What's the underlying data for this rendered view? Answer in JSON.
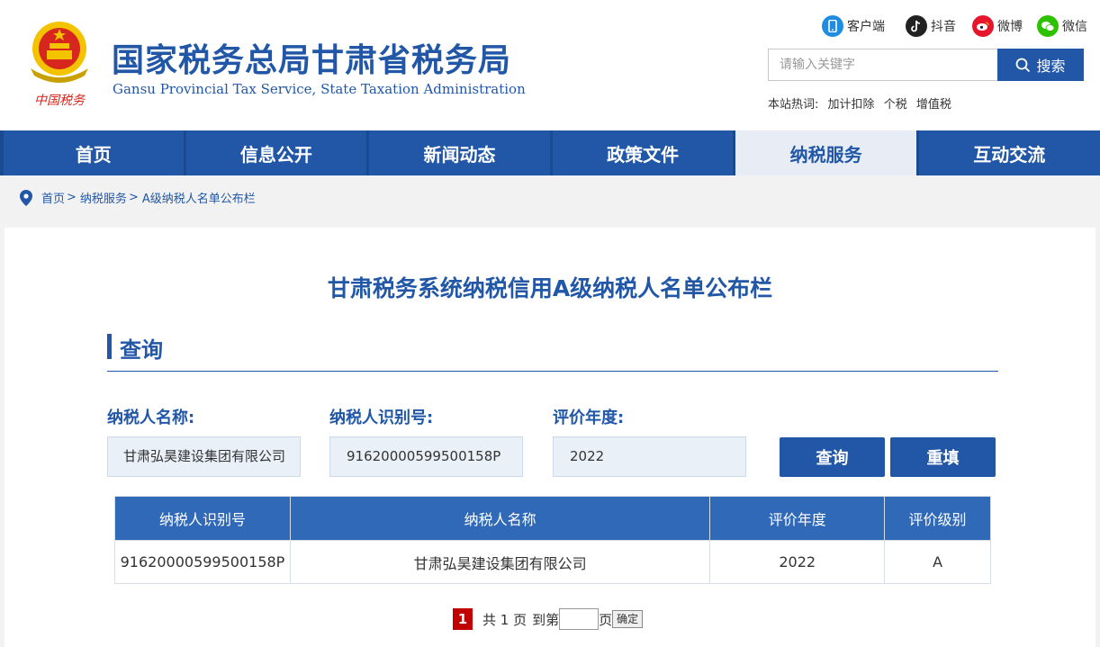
{
  "header": {
    "title": "国家税务总局甘肃省税务局",
    "subtitle": "Gansu Provincial Tax Service, State Taxation Administration",
    "emblem_text": "中国税务",
    "social": [
      {
        "label": "客户端",
        "icon": "mobile-app-icon",
        "color": "#1f8ce0"
      },
      {
        "label": "抖音",
        "icon": "douyin-icon",
        "color": "#222222"
      },
      {
        "label": "微博",
        "icon": "weibo-icon",
        "color": "#e6162d"
      },
      {
        "label": "微信",
        "icon": "wechat-icon",
        "color": "#2dc100"
      }
    ],
    "search": {
      "placeholder": "请输入关键字",
      "button": "搜索"
    },
    "hot": {
      "label": "本站热词:",
      "terms": [
        "加计扣除",
        "个税",
        "增值税"
      ]
    }
  },
  "nav": {
    "items": [
      "首页",
      "信息公开",
      "新闻动态",
      "政策文件",
      "纳税服务",
      "互动交流"
    ],
    "active_index": 4
  },
  "breadcrumb": {
    "items": [
      "首页",
      "纳税服务",
      "A级纳税人名单公布栏"
    ],
    "separator": ">"
  },
  "main": {
    "page_title": "甘肃税务系统纳税信用A级纳税人名单公布栏",
    "section_title": "查询",
    "form": {
      "name_label": "纳税人名称:",
      "name_value": "甘肃弘昊建设集团有限公司",
      "id_label": "纳税人识别号:",
      "id_value": "91620000599500158P",
      "year_label": "评价年度:",
      "year_value": "2022",
      "query_button": "查询",
      "reset_button": "重填"
    },
    "table": {
      "headers": [
        "纳税人识别号",
        "纳税人名称",
        "评价年度",
        "评价级别"
      ],
      "rows": [
        [
          "91620000599500158P",
          "甘肃弘昊建设集团有限公司",
          "2022",
          "A"
        ]
      ]
    },
    "pager": {
      "current": "1",
      "total_text": "共 1 页",
      "goto_prefix": "到第",
      "goto_suffix": "页",
      "confirm": "确定"
    }
  },
  "colors": {
    "brand_blue": "#2157a6",
    "header_blue": "#2f69b8",
    "active_nav_bg": "#e8edf5",
    "pager_red": "#c00000"
  }
}
